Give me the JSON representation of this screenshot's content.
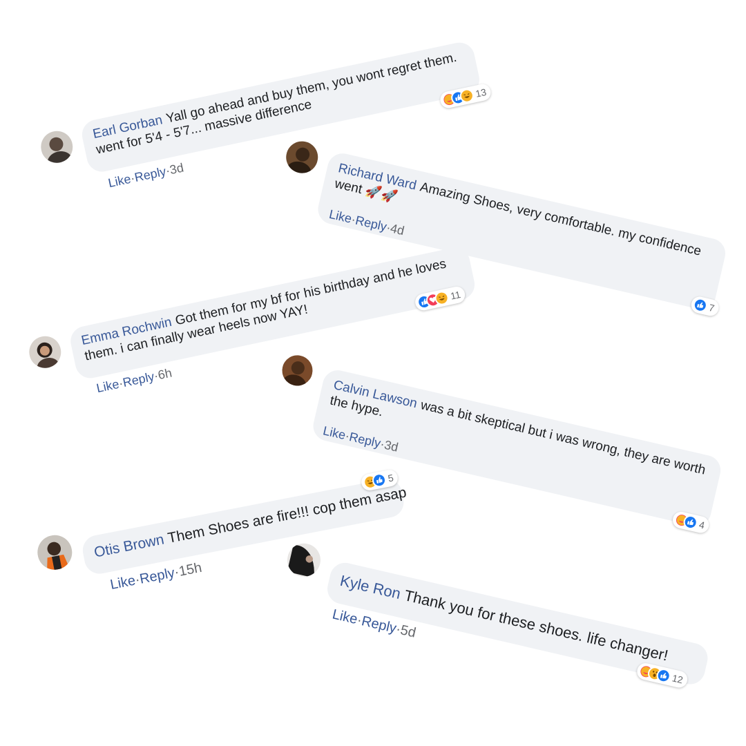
{
  "comments": [
    {
      "author": "Earl Gorban",
      "text": "Yall go ahead and buy them, you wont regret them. went for 5'4 - 5'7... massive difference",
      "like": "Like",
      "reply": "Reply",
      "sep": "·",
      "time": "3d",
      "reaction_count": "13",
      "reactions": [
        "care",
        "like",
        "haha"
      ]
    },
    {
      "author": "Richard Ward",
      "text": "Amazing Shoes, very comfortable. my confidence went 🚀🚀",
      "like": "Like",
      "reply": "Reply",
      "sep": "·",
      "time": "4d",
      "reaction_count": "7",
      "reactions": [
        "like"
      ]
    },
    {
      "author": "Emma Rochwin",
      "text": "Got them for my bf for his birthday and he loves them. i can finally wear heels now YAY!",
      "like": "Like",
      "reply": "Reply",
      "sep": "·",
      "time": "6h",
      "reaction_count": "11",
      "reactions": [
        "like",
        "love",
        "haha"
      ]
    },
    {
      "author": "Calvin Lawson",
      "text": "was a bit skeptical but i was wrong, they are worth the hype.",
      "like": "Like",
      "reply": "Reply",
      "sep": "·",
      "time": "3d",
      "reaction_count": "4",
      "reactions": [
        "care",
        "like"
      ]
    },
    {
      "author": "Otis Brown",
      "text": "Them Shoes are fire!!! cop them asap",
      "like": "Like",
      "reply": "Reply",
      "sep": "·",
      "time": "15h",
      "reaction_count": "5",
      "reactions": [
        "haha",
        "like"
      ]
    },
    {
      "author": "Kyle Ron",
      "text": "Thank you for these shoes. life changer!",
      "like": "Like",
      "reply": "Reply",
      "sep": "·",
      "time": "5d",
      "reaction_count": "12",
      "reactions": [
        "care",
        "wow",
        "like"
      ]
    }
  ],
  "colors": {
    "like": "#1877f2",
    "love": "#f33e58",
    "care": "#f33e58",
    "haha": "#f7b125",
    "wow": "#f7b125",
    "link": "#385898",
    "bubble": "#f0f2f5"
  }
}
